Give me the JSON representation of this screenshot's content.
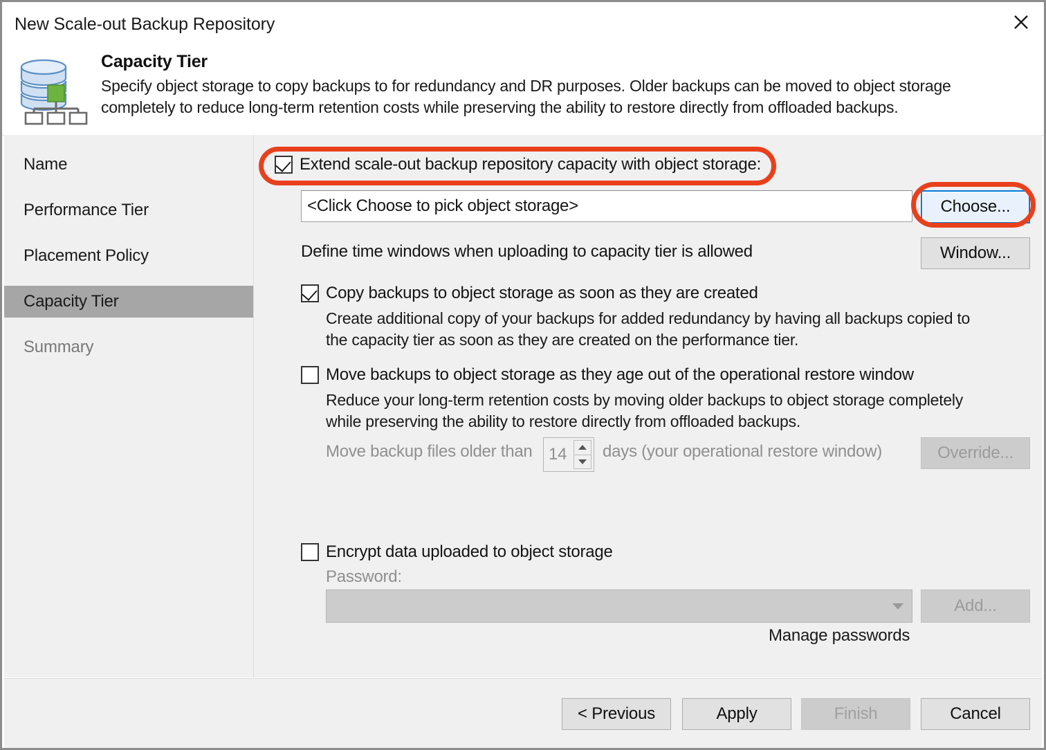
{
  "window": {
    "title": "New Scale-out Backup Repository",
    "close_icon": "close-icon"
  },
  "header": {
    "icon": "scale-out-repository-icon",
    "title": "Capacity Tier",
    "description": "Specify object storage to copy backups to for redundancy and DR purposes. Older backups can be moved to object storage completely to reduce long-term retention costs while preserving the ability to restore directly from offloaded backups."
  },
  "sidebar": {
    "items": [
      {
        "label": "Name",
        "state": "normal"
      },
      {
        "label": "Performance Tier",
        "state": "normal"
      },
      {
        "label": "Placement Policy",
        "state": "normal"
      },
      {
        "label": "Capacity Tier",
        "state": "active"
      },
      {
        "label": "Summary",
        "state": "dim"
      }
    ]
  },
  "main": {
    "extend": {
      "label": "Extend scale-out backup repository capacity with object storage:",
      "checked": true
    },
    "storage_input": {
      "value": "<Click Choose to pick object storage>"
    },
    "choose_button": {
      "label": "Choose...",
      "focused": true
    },
    "time_window": {
      "label": "Define time windows when uploading to capacity tier is allowed",
      "button_label": "Window..."
    },
    "copy_option": {
      "label": "Copy backups to object storage as soon as they are created",
      "checked": true,
      "description_line1": "Create additional copy of your backups for added redundancy by having all backups copied to",
      "description_line2": "the capacity tier as soon as they are created on the performance tier."
    },
    "move_option": {
      "label": "Move backups to object storage as they age out of the operational restore window",
      "checked": false,
      "description_line1": "Reduce your long-term retention costs by moving older backups to object storage completely",
      "description_line2": "while preserving the ability to restore directly from offloaded backups.",
      "older_than_prefix": "Move backup files older than",
      "days_value": "14",
      "older_than_suffix": "days (your operational restore window)",
      "override_button_label": "Override...",
      "disabled": true
    },
    "encrypt_option": {
      "label": "Encrypt data uploaded to object storage",
      "checked": false,
      "password_label": "Password:",
      "password_value": "",
      "add_button_label": "Add...",
      "manage_link_label": "Manage passwords",
      "disabled": true
    }
  },
  "footer": {
    "previous_label": "< Previous",
    "apply_label": "Apply",
    "finish_label": "Finish",
    "cancel_label": "Cancel",
    "finish_disabled": true
  },
  "annotations": {
    "color": "#e8401c",
    "highlight_1": "extend-checkbox-row-highlight",
    "highlight_2": "choose-button-highlight"
  }
}
